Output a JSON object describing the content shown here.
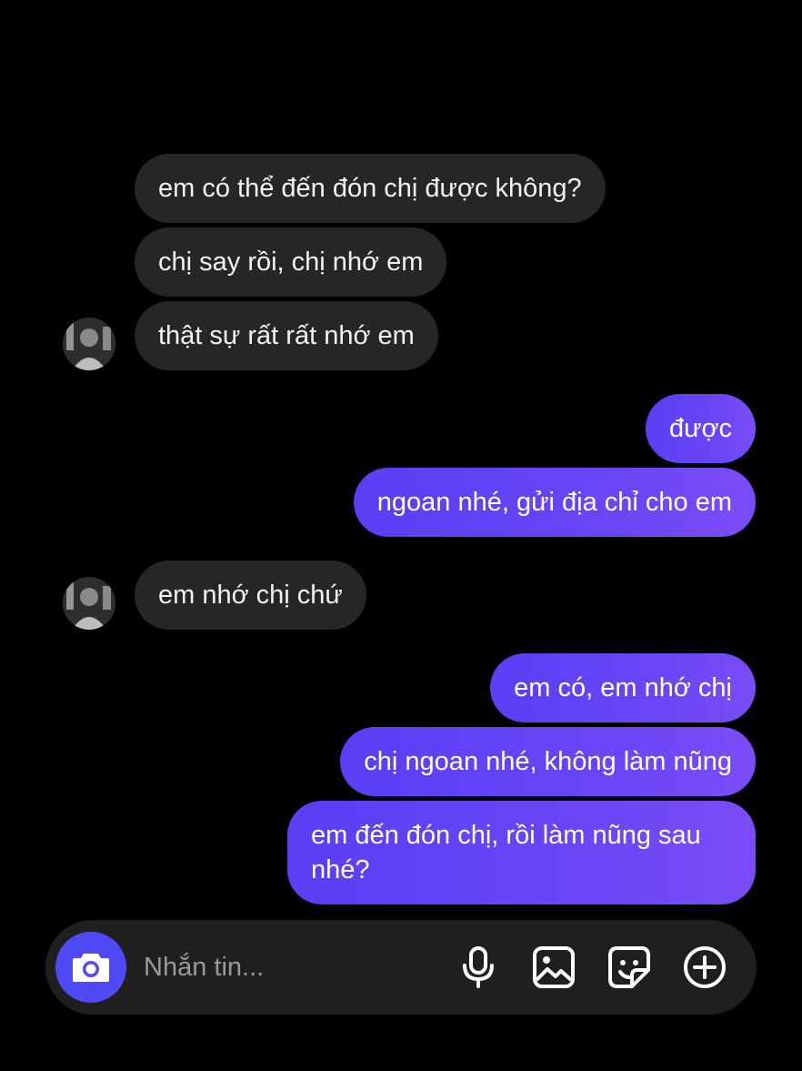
{
  "chat": {
    "messages": [
      {
        "from": "other",
        "text": "em có thể đến đón chị được không?"
      },
      {
        "from": "other",
        "text": "chị say rồi, chị nhớ em"
      },
      {
        "from": "other",
        "text": "thật sự rất rất nhớ em"
      },
      {
        "from": "me",
        "text": "được"
      },
      {
        "from": "me",
        "text": "ngoan nhé, gửi địa chỉ cho em"
      },
      {
        "from": "other",
        "text": "em nhớ chị chứ"
      },
      {
        "from": "me",
        "text": "em có, em nhớ chị"
      },
      {
        "from": "me",
        "text": "chị ngoan nhé, không làm nũng"
      },
      {
        "from": "me",
        "text": "em đến đón chị, rồi làm nũng sau nhé?"
      }
    ]
  },
  "composer": {
    "placeholder": "Nhắn tin...",
    "icons": [
      "camera-icon",
      "microphone-icon",
      "gallery-icon",
      "sticker-icon",
      "add-icon"
    ]
  },
  "colors": {
    "background": "#000000",
    "received_bubble": "#262626",
    "sent_bubble": "#6845f6",
    "camera_button": "#4f4af3"
  }
}
